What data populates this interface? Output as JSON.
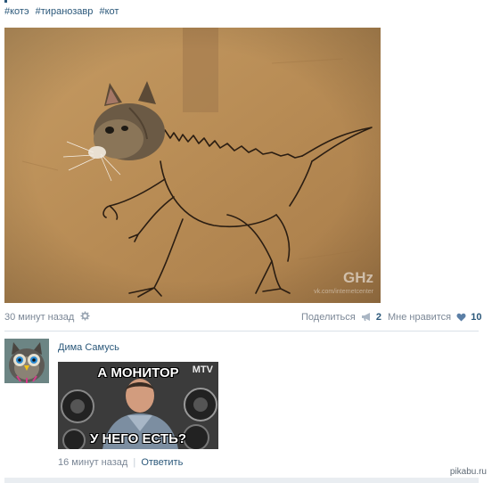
{
  "post": {
    "tags": [
      "#котэ",
      "#тиранозавр",
      "#кот"
    ],
    "image": {
      "description_icon": "cat-dinosaur-drawing",
      "watermark": "GHz",
      "watermark_sub": "vk.com/internetcenter"
    },
    "meta": {
      "time": "30 минут назад",
      "share_label": "Поделиться",
      "share_count": "2",
      "like_label": "Мне нравится",
      "like_count": "10"
    }
  },
  "comment": {
    "author": "Дима Самусь",
    "meme": {
      "top_text": "А МОНИТОР",
      "bottom_text": "У НЕГО ЕСТЬ?",
      "logo": "MTV"
    },
    "time": "16 минут назад",
    "separator": "|",
    "reply_label": "Ответить"
  },
  "footer": {
    "watermark": "pikabu.ru"
  },
  "colors": {
    "link": "#2b587a",
    "meta": "#7b8796",
    "cardboard": "#b98f58",
    "divider": "#dae1e8"
  }
}
